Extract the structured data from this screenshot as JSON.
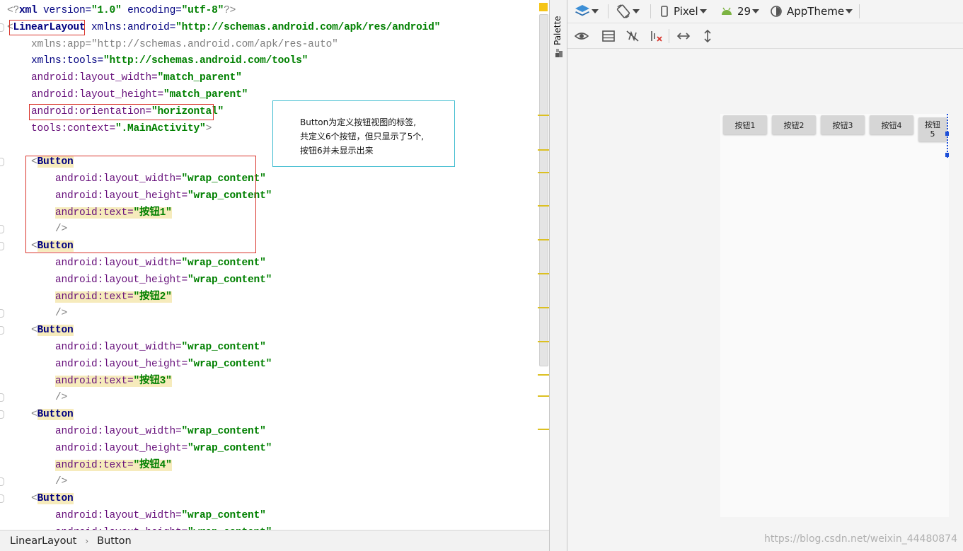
{
  "editor": {
    "lines": [
      {
        "segments": [
          {
            "t": "<?",
            "c": "t-gray"
          },
          {
            "t": "xml",
            "c": "t-tag"
          },
          {
            "t": " version=",
            "c": "t-ns"
          },
          {
            "t": "\"1.0\"",
            "c": "t-val"
          },
          {
            "t": " encoding=",
            "c": "t-ns"
          },
          {
            "t": "\"utf-8\"",
            "c": "t-val"
          },
          {
            "t": "?>",
            "c": "t-gray"
          }
        ]
      },
      {
        "segments": [
          {
            "t": "<",
            "c": "t-gray"
          },
          {
            "t": "LinearLayout",
            "c": "t-tag"
          },
          {
            "t": " xmlns:android=",
            "c": "t-ns"
          },
          {
            "t": "\"http://schemas.android.com/apk/res/android\"",
            "c": "t-val"
          }
        ]
      },
      {
        "segments": [
          {
            "t": "    xmlns:app=",
            "c": "t-gray"
          },
          {
            "t": "\"http://schemas.android.com/apk/res-auto\"",
            "c": "t-gray"
          }
        ]
      },
      {
        "segments": [
          {
            "t": "    xmlns:tools=",
            "c": "t-ns"
          },
          {
            "t": "\"http://schemas.android.com/tools\"",
            "c": "t-val"
          }
        ]
      },
      {
        "segments": [
          {
            "t": "    android:layout_width=",
            "c": "t-attr"
          },
          {
            "t": "\"match_parent\"",
            "c": "t-val"
          }
        ]
      },
      {
        "segments": [
          {
            "t": "    android:layout_height=",
            "c": "t-attr"
          },
          {
            "t": "\"match_parent\"",
            "c": "t-val"
          }
        ]
      },
      {
        "segments": [
          {
            "t": "    android:orientation=",
            "c": "t-attr"
          },
          {
            "t": "\"horizontal\"",
            "c": "t-val"
          }
        ]
      },
      {
        "segments": [
          {
            "t": "    tools:context=",
            "c": "t-attr"
          },
          {
            "t": "\".MainActivity\"",
            "c": "t-val"
          },
          {
            "t": ">",
            "c": "t-gray"
          }
        ]
      },
      {
        "segments": []
      },
      {
        "segments": [
          {
            "t": "    <",
            "c": "t-gray"
          },
          {
            "t": "Button",
            "c": "t-hl-strong"
          }
        ]
      },
      {
        "segments": [
          {
            "t": "        android:layout_width=",
            "c": "t-attr"
          },
          {
            "t": "\"wrap_content\"",
            "c": "t-val"
          }
        ]
      },
      {
        "segments": [
          {
            "t": "        android:layout_height=",
            "c": "t-attr"
          },
          {
            "t": "\"wrap_content\"",
            "c": "t-val"
          }
        ]
      },
      {
        "segments": [
          {
            "t": "        ",
            "c": "t-black"
          },
          {
            "t": "android:text=",
            "c": "t-attr t-hl"
          },
          {
            "t": "\"按钮1\"",
            "c": "t-val t-hl"
          }
        ]
      },
      {
        "segments": [
          {
            "t": "        />",
            "c": "t-gray"
          }
        ]
      },
      {
        "segments": [
          {
            "t": "    <",
            "c": "t-gray"
          },
          {
            "t": "Button",
            "c": "t-hl-strong"
          }
        ]
      },
      {
        "segments": [
          {
            "t": "        android:layout_width=",
            "c": "t-attr"
          },
          {
            "t": "\"wrap_content\"",
            "c": "t-val"
          }
        ]
      },
      {
        "segments": [
          {
            "t": "        android:layout_height=",
            "c": "t-attr"
          },
          {
            "t": "\"wrap_content\"",
            "c": "t-val"
          }
        ]
      },
      {
        "segments": [
          {
            "t": "        ",
            "c": "t-black"
          },
          {
            "t": "android:text=",
            "c": "t-attr t-hl"
          },
          {
            "t": "\"按钮2\"",
            "c": "t-val t-hl"
          }
        ]
      },
      {
        "segments": [
          {
            "t": "        />",
            "c": "t-gray"
          }
        ]
      },
      {
        "segments": [
          {
            "t": "    <",
            "c": "t-gray"
          },
          {
            "t": "Button",
            "c": "t-hl-strong"
          }
        ]
      },
      {
        "segments": [
          {
            "t": "        android:layout_width=",
            "c": "t-attr"
          },
          {
            "t": "\"wrap_content\"",
            "c": "t-val"
          }
        ]
      },
      {
        "segments": [
          {
            "t": "        android:layout_height=",
            "c": "t-attr"
          },
          {
            "t": "\"wrap_content\"",
            "c": "t-val"
          }
        ]
      },
      {
        "segments": [
          {
            "t": "        ",
            "c": "t-black"
          },
          {
            "t": "android:text=",
            "c": "t-attr t-hl"
          },
          {
            "t": "\"按钮3\"",
            "c": "t-val t-hl"
          }
        ]
      },
      {
        "segments": [
          {
            "t": "        />",
            "c": "t-gray"
          }
        ]
      },
      {
        "segments": [
          {
            "t": "    <",
            "c": "t-gray"
          },
          {
            "t": "Button",
            "c": "t-hl-strong"
          }
        ]
      },
      {
        "segments": [
          {
            "t": "        android:layout_width=",
            "c": "t-attr"
          },
          {
            "t": "\"wrap_content\"",
            "c": "t-val"
          }
        ]
      },
      {
        "segments": [
          {
            "t": "        android:layout_height=",
            "c": "t-attr"
          },
          {
            "t": "\"wrap_content\"",
            "c": "t-val"
          }
        ]
      },
      {
        "segments": [
          {
            "t": "        ",
            "c": "t-black"
          },
          {
            "t": "android:text=",
            "c": "t-attr t-hl"
          },
          {
            "t": "\"按钮4\"",
            "c": "t-val t-hl"
          }
        ]
      },
      {
        "segments": [
          {
            "t": "        />",
            "c": "t-gray"
          }
        ]
      },
      {
        "segments": [
          {
            "t": "    <",
            "c": "t-gray"
          },
          {
            "t": "Button",
            "c": "t-hl-strong"
          }
        ]
      },
      {
        "segments": [
          {
            "t": "        android:layout_width=",
            "c": "t-attr"
          },
          {
            "t": "\"wrap_content\"",
            "c": "t-val"
          }
        ]
      },
      {
        "segments": [
          {
            "t": "        android:layout_height=",
            "c": "t-attr"
          },
          {
            "t": "\"wrap_content\"",
            "c": "t-val"
          }
        ]
      }
    ]
  },
  "annotation": {
    "line1": "Button为定义按钮视图的标签,",
    "line2": "共定义6个按钮，但只显示了5个,",
    "line3": "按钮6并未显示出来"
  },
  "breadcrumb": {
    "item1": "LinearLayout",
    "separator": "›",
    "item2": "Button"
  },
  "palette": {
    "label": "Palette"
  },
  "toolbar": {
    "device": "Pixel",
    "api_level": "29",
    "theme": "AppTheme"
  },
  "preview": {
    "buttons": [
      "按钮1",
      "按钮2",
      "按钮3",
      "按钮4"
    ],
    "button5_line1": "按钮",
    "button5_line2": "5"
  },
  "watermark": "https://blog.csdn.net/weixin_44480874",
  "colors": {
    "tag": "#000080",
    "attribute": "#660e7a",
    "value": "#008000",
    "highlight": "#f6ebbc",
    "annotation_border": "#3fbcd0",
    "red_box": "#d9342b",
    "selection": "#1d4fd8"
  }
}
